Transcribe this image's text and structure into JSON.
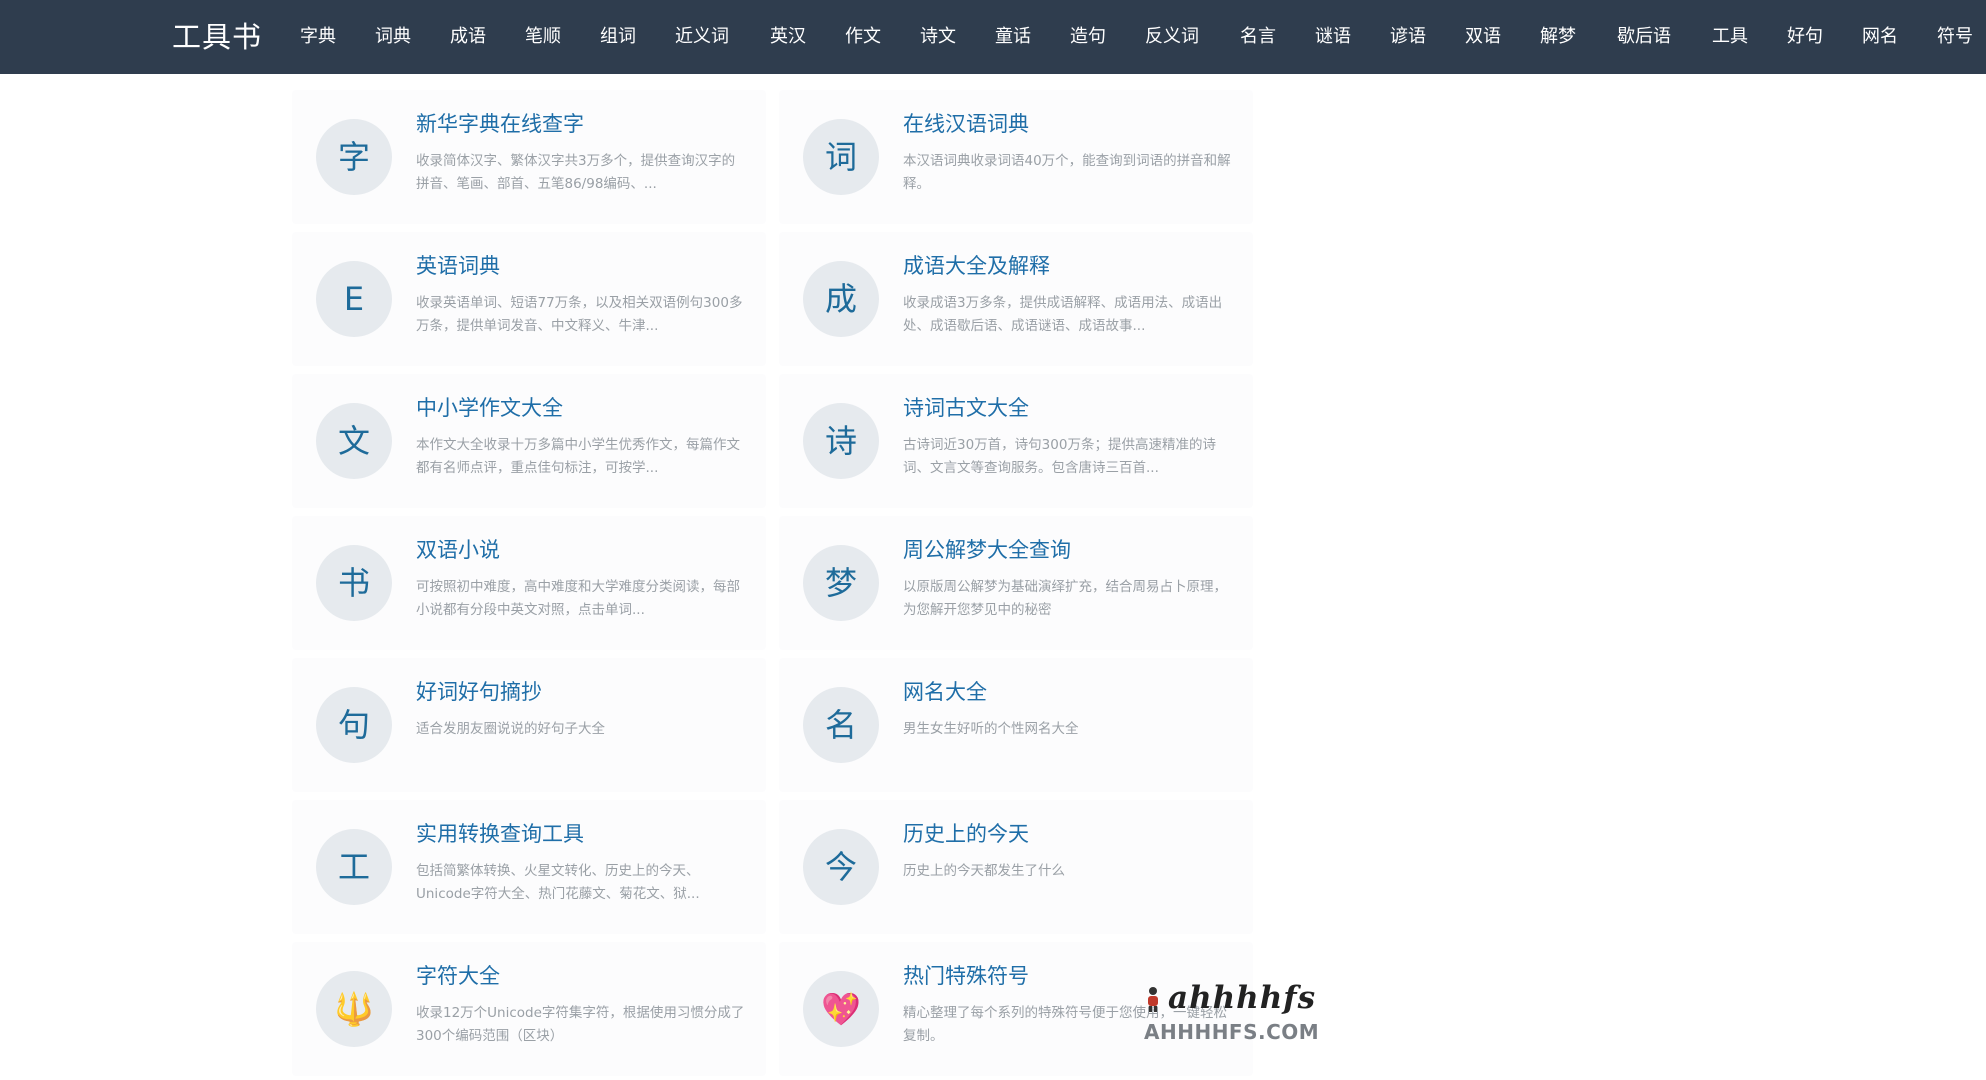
{
  "header": {
    "logo": "工具书",
    "nav": [
      "字典",
      "词典",
      "成语",
      "笔顺",
      "组词",
      "近义词",
      "英汉",
      "作文",
      "诗文",
      "童话",
      "造句",
      "反义词",
      "名言",
      "谜语",
      "谚语",
      "双语",
      "解梦",
      "歇后语",
      "工具",
      "好句",
      "网名",
      "符号"
    ]
  },
  "cards": [
    {
      "icon": "字",
      "title": "新华字典在线查字",
      "desc": "收录简体汉字、繁体汉字共3万多个，提供查询汉字的拼音、笔画、部首、五笔86/98编码、..."
    },
    {
      "icon": "词",
      "title": "在线汉语词典",
      "desc": "本汉语词典收录词语40万个，能查询到词语的拼音和解释。"
    },
    {
      "icon": "E",
      "title": "英语词典",
      "desc": "收录英语单词、短语77万条，以及相关双语例句300多万条，提供单词发音、中文释义、牛津..."
    },
    {
      "icon": "成",
      "title": "成语大全及解释",
      "desc": "收录成语3万多条，提供成语解释、成语用法、成语出处、成语歇后语、成语谜语、成语故事..."
    },
    {
      "icon": "文",
      "title": "中小学作文大全",
      "desc": "本作文大全收录十万多篇中小学生优秀作文，每篇作文都有名师点评，重点佳句标注，可按学..."
    },
    {
      "icon": "诗",
      "title": "诗词古文大全",
      "desc": "古诗词近30万首，诗句300万条；提供高速精准的诗词、文言文等查询服务。包含唐诗三百首..."
    },
    {
      "icon": "书",
      "title": "双语小说",
      "desc": "可按照初中难度，高中难度和大学难度分类阅读，每部小说都有分段中英文对照，点击单词..."
    },
    {
      "icon": "梦",
      "title": "周公解梦大全查询",
      "desc": "以原版周公解梦为基础演绎扩充，结合周易占卜原理，为您解开您梦见中的秘密"
    },
    {
      "icon": "句",
      "title": "好词好句摘抄",
      "desc": "适合发朋友圈说说的好句子大全"
    },
    {
      "icon": "名",
      "title": "网名大全",
      "desc": "男生女生好听的个性网名大全"
    },
    {
      "icon": "工",
      "title": "实用转换查询工具",
      "desc": "包括简繁体转换、火星文转化、历史上的今天、Unicode字符大全、热门花藤文、菊花文、狱..."
    },
    {
      "icon": "今",
      "title": "历史上的今天",
      "desc": "历史上的今天都发生了什么"
    },
    {
      "icon": "🔱",
      "title": "字符大全",
      "desc": "收录12万个Unicode字符集字符，根据使用习惯分成了300个编码范围（区块）"
    },
    {
      "icon": "💖",
      "title": "热门特殊符号",
      "desc": "精心整理了每个系列的特殊符号便于您使用，一键轻松复制。"
    }
  ],
  "watermark": {
    "logo": "ahhhhfs",
    "text": "AHHHHFS.COM"
  }
}
